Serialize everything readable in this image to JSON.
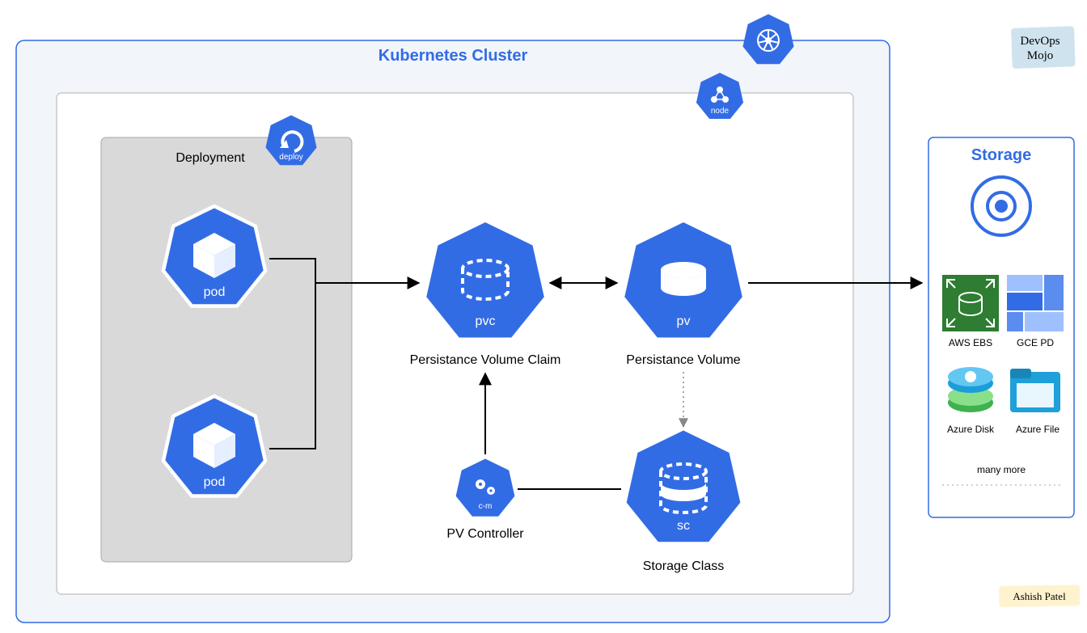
{
  "cluster": {
    "title": "Kubernetes Cluster"
  },
  "deployment": {
    "title": "Deployment",
    "badge": "deploy"
  },
  "pod1": {
    "label": "pod"
  },
  "pod2": {
    "label": "pod"
  },
  "pvc": {
    "label": "pvc",
    "caption": "Persistance Volume Claim"
  },
  "pv": {
    "label": "pv",
    "caption": "Persistance Volume"
  },
  "sc": {
    "label": "sc",
    "caption": "Storage Class"
  },
  "cm": {
    "label": "c-m",
    "caption": "PV Controller"
  },
  "node": {
    "label": "node"
  },
  "storage": {
    "title": "Storage",
    "items": {
      "aws": "AWS EBS",
      "gce": "GCE PD",
      "adisk": "Azure Disk",
      "afile": "Azure File",
      "more": "many more"
    }
  },
  "brand": {
    "line1": "DevOps",
    "line2": "Mojo"
  },
  "author": "Ashish Patel"
}
